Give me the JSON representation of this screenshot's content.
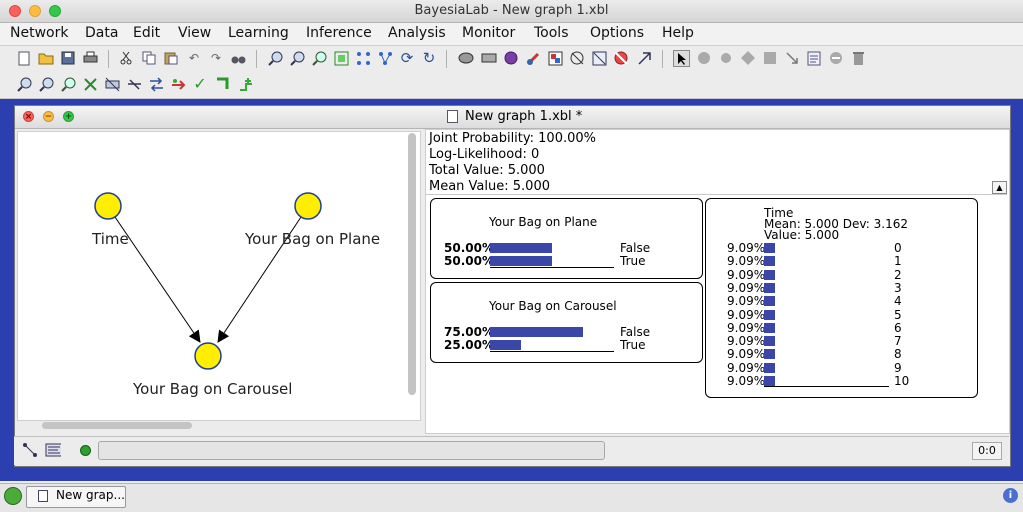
{
  "window": {
    "title": "BayesiaLab - New graph 1.xbl"
  },
  "menu": [
    "Network",
    "Data",
    "Edit",
    "View",
    "Learning",
    "Inference",
    "Analysis",
    "Monitor",
    "Tools",
    "Options",
    "Help"
  ],
  "toolbar1": [
    "new-icon",
    "open-icon",
    "save-icon",
    "print-icon",
    "cut-icon",
    "copy-icon",
    "paste-icon",
    "undo-icon",
    "redo-icon",
    "find-icon",
    "zoom-in-icon",
    "zoom-out-icon",
    "zoom-fit-icon",
    "layout-icon",
    "align-icon",
    "align-vertical-icon",
    "refresh-icon",
    "reload-icon",
    "network-icon",
    "db-icon",
    "globe-icon",
    "edit-node-icon",
    "palette-icon",
    "no-link-icon",
    "image-icon",
    "block-icon",
    "arrow-select-icon",
    "pointer-icon",
    "node-circle-icon",
    "node-utility-icon",
    "node-decision-icon",
    "node-square-icon",
    "link-arrow-icon",
    "note-icon",
    "minus-node-icon",
    "trash-icon"
  ],
  "toolbar2": [
    "zoom-in-icon",
    "zoom-out-icon",
    "zoom-fit-icon",
    "hide-icon",
    "filter-icon",
    "unlink-icon",
    "flip-icon",
    "arrow-right-icon",
    "check-icon",
    "corner-icon",
    "add-node-icon"
  ],
  "doc": {
    "title": "New graph 1.xbl *"
  },
  "graph": {
    "nodes": [
      {
        "label": "Time"
      },
      {
        "label": "Your Bag on Plane"
      },
      {
        "label": "Your Bag on Carousel"
      }
    ]
  },
  "stats": {
    "joint": "Joint Probability: 100.00%",
    "loglik": "Log-Likelihood: 0",
    "total": "Total Value: 5.000",
    "mean": "Mean Value: 5.000"
  },
  "monitors": {
    "plane": {
      "title": "Your Bag on Plane",
      "rows": [
        {
          "pct": "50.00%",
          "state": "False",
          "value": 0.5
        },
        {
          "pct": "50.00%",
          "state": "True",
          "value": 0.5
        }
      ]
    },
    "carousel": {
      "title": "Your Bag on Carousel",
      "rows": [
        {
          "pct": "75.00%",
          "state": "False",
          "value": 0.75
        },
        {
          "pct": "25.00%",
          "state": "True",
          "value": 0.25
        }
      ]
    },
    "time": {
      "title": "Time",
      "meandev": "Mean: 5.000 Dev: 3.162",
      "value": "Value: 5.000",
      "rows": [
        {
          "pct": "9.09%",
          "state": "0",
          "value": 0.0909
        },
        {
          "pct": "9.09%",
          "state": "1",
          "value": 0.0909
        },
        {
          "pct": "9.09%",
          "state": "2",
          "value": 0.0909
        },
        {
          "pct": "9.09%",
          "state": "3",
          "value": 0.0909
        },
        {
          "pct": "9.09%",
          "state": "4",
          "value": 0.0909
        },
        {
          "pct": "9.09%",
          "state": "5",
          "value": 0.0909
        },
        {
          "pct": "9.09%",
          "state": "6",
          "value": 0.0909
        },
        {
          "pct": "9.09%",
          "state": "7",
          "value": 0.0909
        },
        {
          "pct": "9.09%",
          "state": "8",
          "value": 0.0909
        },
        {
          "pct": "9.09%",
          "state": "9",
          "value": 0.0909
        },
        {
          "pct": "9.09%",
          "state": "10",
          "value": 0.0909
        }
      ]
    }
  },
  "status": {
    "coord": "0:0"
  },
  "taskbar": {
    "item": "New grap..."
  },
  "colors": {
    "node_fill": "#ffee00",
    "bar": "#3a47a8",
    "desktop": "#2b3fb0"
  }
}
